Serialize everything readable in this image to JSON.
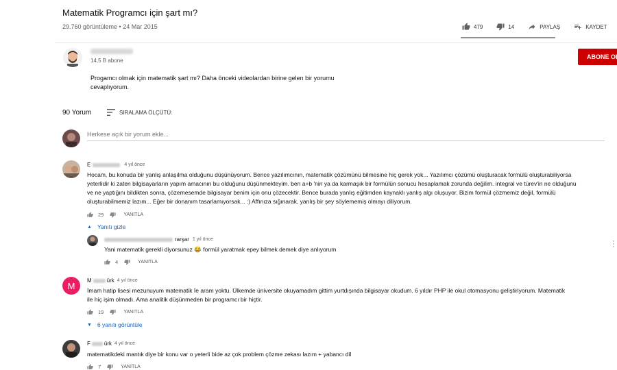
{
  "video": {
    "title": "Matematik Programcı için şart mı?",
    "meta": "29.760 görüntüleme • 24 Mar 2015",
    "likes": "479",
    "dislikes": "14",
    "share_label": "PAYLAŞ",
    "save_label": "KAYDET"
  },
  "channel": {
    "subscribers": "14,5 B abone",
    "description_line1": "Progamcı olmak için matematik şart mı? Daha önceki videolardan birine gelen bir yorumu",
    "description_line2": "cevaplıyorum.",
    "subscribe_label": "ABONE OL"
  },
  "comments_header": {
    "count": "90 Yorum",
    "sort_label": "SIRALAMA ÖLÇÜTÜ:",
    "add_placeholder": "Herkese açık bir yorum ekle..."
  },
  "comments": [
    {
      "name_prefix": "E",
      "time": "4 yıl önce",
      "lines": [
        "Hocam, bu konuda bir yanlış anlaşılma olduğunu düşünüyorum. Bence yazılımcının, matematik çözümünü bilmesine hiç gerek yok... Yazılımcı çözümü oluşturacak formülü oluşturabiliyorsa",
        "yeterlidir ki zaten bilgisayarların yapım amacının bu olduğunu düşünmekteyim. ben a+b 'nin ya da karmaşık bir formülün sonucu hesaplamak zorunda değilim. integral ve türev'in ne olduğunu",
        "ve ne yaptığını bildikten sonra, çözemesemde bilgisayar benim için onu çözecektir. Bence burada yanlış eğitimden kaynaklı yanlış algı oluşuyor. Bizim formül çözmemiz değil, formülü",
        "oluşturabilmemiz lazım... Eğer bir donanım tasarlamıyorsak... :) Affınıza sığınarak, yanlış bir şey söylememiş olmayı diliyorum."
      ],
      "likes": "29",
      "reply_label": "YANITLA",
      "replies_toggle": "Yanıtı gizle"
    },
    {
      "name_suffix": "rarşar",
      "time": "1 yıl önce",
      "text_before": "Yani matematik gerekli diyorsunuz",
      "emoji": "😂",
      "text_after": "formül yaratmak epey bilmek demek diye anlıyorum",
      "likes": "4",
      "reply_label": "YANITLA"
    },
    {
      "avatar_letter": "M",
      "name_prefix": "M",
      "name_suffix": "ürk",
      "time": "4 yıl önce",
      "lines": [
        "İmam hatip lisesi mezunuyum matematik İe aram yoktu. Ülkemde üniversite okuyamadım gittim yurtdışında bilgisayar okudum. 6 yıldır PHP ile okul otomasyonu geliştiriyorum. Matematik",
        "ile hiç işim olmadı. Ama analitik düşünmeden bir programcı bir hiçtir."
      ],
      "likes": "19",
      "reply_label": "YANITLA",
      "replies_toggle": "6 yanıtı görüntüle"
    },
    {
      "name_prefix": "F",
      "name_suffix": "ürk",
      "time": "4 yıl önce",
      "text": "matematikdeki mantık diye bir konu var o yeterli bide az çok problem çözme zekası lazım + yabancı dil",
      "likes": "7",
      "reply_label": "YANITLA"
    }
  ],
  "colors": {
    "subscribe_red": "#cc0000",
    "link_blue": "#1565c0",
    "avatar_m": "#e91e63"
  }
}
